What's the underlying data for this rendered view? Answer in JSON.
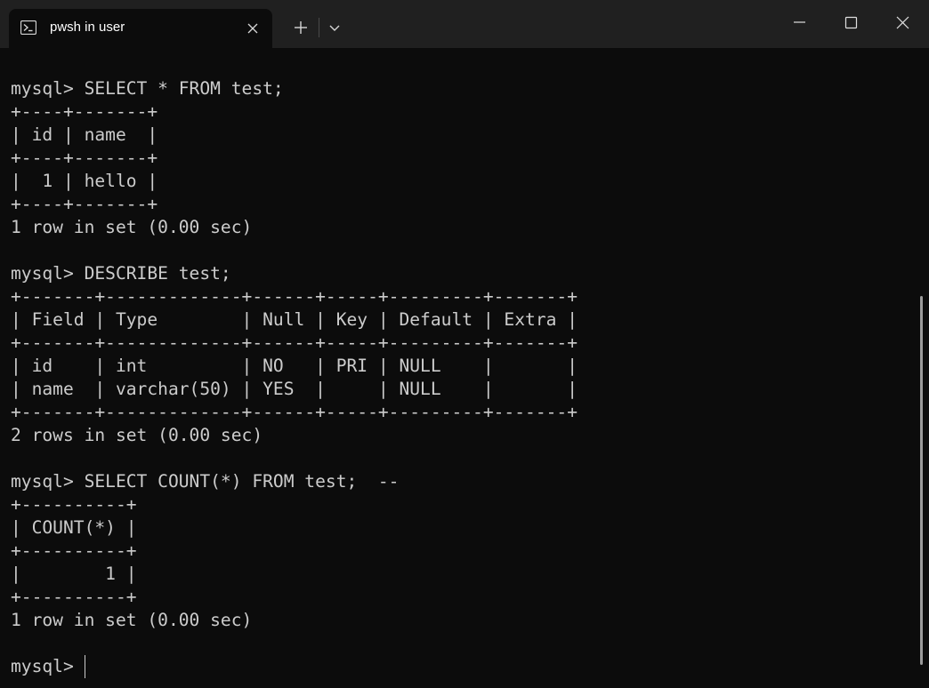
{
  "window": {
    "tab_title": "pwsh in user",
    "tab_icon": "powershell-icon",
    "new_tab_icon": "plus-icon",
    "dropdown_icon": "chevron-down-icon",
    "minimize_icon": "minimize-icon",
    "maximize_icon": "maximize-icon",
    "close_icon": "close-icon"
  },
  "terminal": {
    "lines": [
      "mysql> SELECT * FROM test;",
      "+----+-------+",
      "| id | name  |",
      "+----+-------+",
      "|  1 | hello |",
      "+----+-------+",
      "1 row in set (0.00 sec)",
      "",
      "mysql> DESCRIBE test;",
      "+-------+-------------+------+-----+---------+-------+",
      "| Field | Type        | Null | Key | Default | Extra |",
      "+-------+-------------+------+-----+---------+-------+",
      "| id    | int         | NO   | PRI | NULL    |       |",
      "| name  | varchar(50) | YES  |     | NULL    |       |",
      "+-------+-------------+------+-----+---------+-------+",
      "2 rows in set (0.00 sec)",
      "",
      "mysql> SELECT COUNT(*) FROM test;  --",
      "+----------+",
      "| COUNT(*) |",
      "+----------+",
      "|        1 |",
      "+----------+",
      "1 row in set (0.00 sec)",
      "",
      "mysql> "
    ]
  },
  "colors": {
    "terminal_background": "#0c0c0c",
    "titlebar_background": "#202020",
    "text": "#cccccc"
  }
}
